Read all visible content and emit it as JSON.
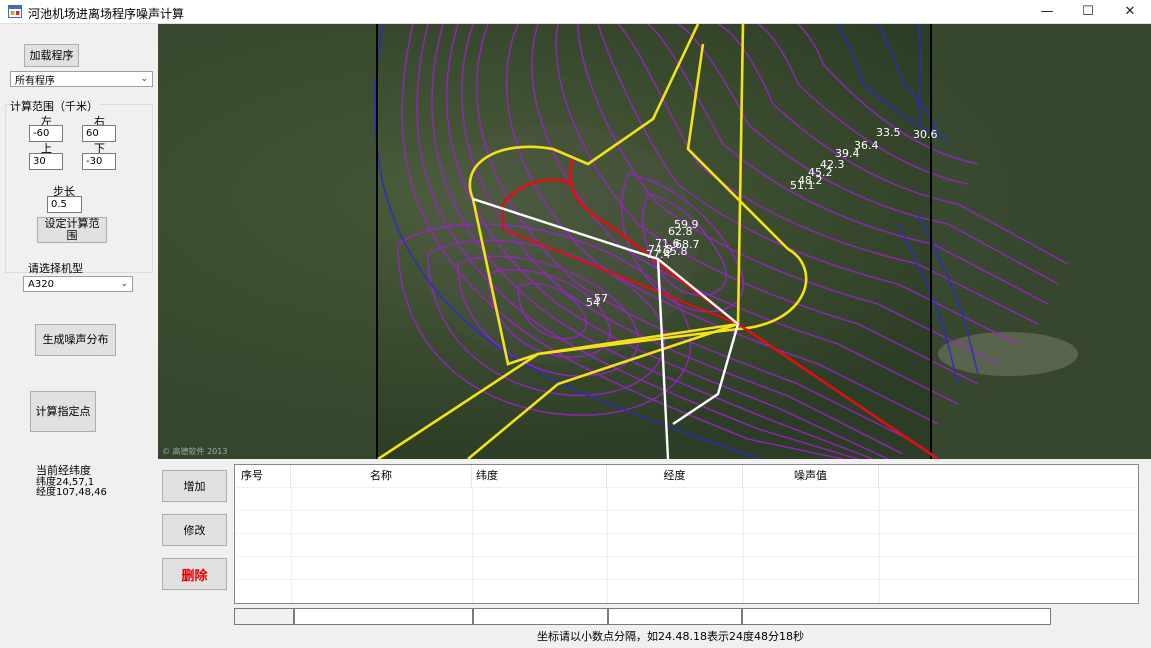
{
  "window": {
    "title": "河池机场进离场程序噪声计算",
    "icon": "app-form-icon",
    "controls": {
      "minimize": "—",
      "maximize": "☐",
      "close": "✕"
    }
  },
  "left_panel": {
    "load_button": "加载程序",
    "procedure_select": "所有程序",
    "range_group_title": "计算范围（千米）",
    "range": {
      "left_label": "左",
      "left_value": "-60",
      "right_label": "右",
      "right_value": "60",
      "top_label": "上",
      "top_value": "30",
      "bottom_label": "下",
      "bottom_value": "-30"
    },
    "step_label": "步长",
    "step_value": "0.5",
    "set_range_button": "设定计算范围",
    "aircraft_label": "请选择机型",
    "aircraft_select": "A320",
    "generate_button": "生成噪声分布",
    "calc_point_button": "计算指定点",
    "coords": {
      "title": "当前经纬度",
      "lat": "纬度24,57,1",
      "lon": "经度107,48,46"
    }
  },
  "map": {
    "contour_labels": [
      "33.5",
      "30.6",
      "36.4",
      "39.4",
      "42.3",
      "45.2",
      "48.2",
      "51.1",
      "59.9",
      "62.8",
      "71.6",
      "74.5",
      "77.4",
      "68.7",
      "65.8",
      "54",
      "57"
    ],
    "copyright": "© 高德软件 2013"
  },
  "bottom": {
    "add_button": "增加",
    "edit_button": "修改",
    "delete_button": "删除",
    "delete_color": "#e00000",
    "table_headers": [
      "序号",
      "名称",
      "纬度",
      "经度",
      "噪声值"
    ],
    "hint": "坐标请以小数点分隔，如24.48.18表示24度48分18秒"
  },
  "colors": {
    "contour_purple": "#a020d0",
    "contour_blue": "#2020c0",
    "route_yellow": "#f2e21a",
    "route_red": "#e01010",
    "route_white": "#ffffff"
  }
}
